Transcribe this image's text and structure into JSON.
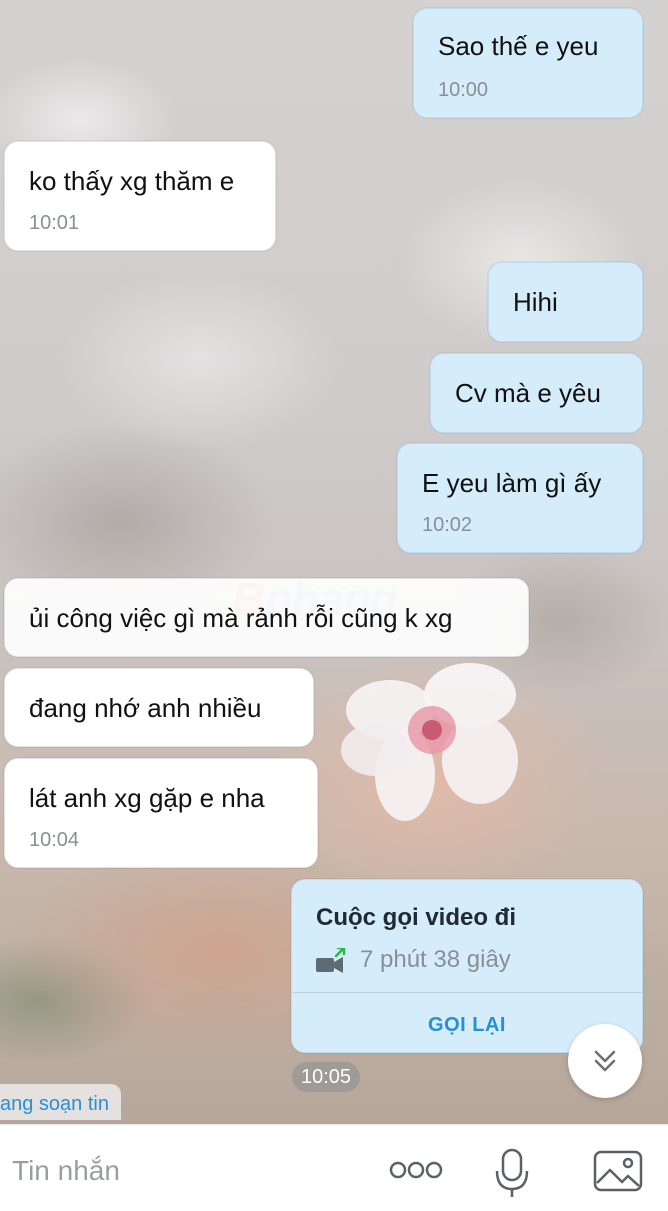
{
  "messages": [
    {
      "side": "out",
      "text": "Sao thế e yeu",
      "time": "10:00"
    },
    {
      "side": "in",
      "text": "ko thấy xg thăm e",
      "time": "10:01"
    },
    {
      "side": "out",
      "text": "Hihi",
      "time": ""
    },
    {
      "side": "out",
      "text": "Cv mà e yêu",
      "time": ""
    },
    {
      "side": "out",
      "text": "E yeu làm gì ấy",
      "time": "10:02"
    },
    {
      "side": "in",
      "text": "ủi công việc gì mà rảnh rỗi cũng k xg",
      "time": ""
    },
    {
      "side": "in",
      "text": "đang nhớ anh nhiều",
      "time": ""
    },
    {
      "side": "in",
      "text": "lát anh xg gặp e nha",
      "time": "10:04"
    }
  ],
  "call_card": {
    "title": "Cuộc gọi video đi",
    "duration": "7 phút 38 giây",
    "action": "GỌI LẠI"
  },
  "time_chip": "10:05",
  "watermark": {
    "part1": "B",
    "part2": "phang"
  },
  "typing_indicator": "ang soạn tin",
  "composer": {
    "placeholder": "Tin nhắn",
    "icons": [
      "more-icon",
      "microphone-icon",
      "image-icon"
    ]
  },
  "colors": {
    "outgoing_bubble": "#d5ecfb",
    "incoming_bubble": "#ffffff",
    "accent": "#2590d8"
  }
}
